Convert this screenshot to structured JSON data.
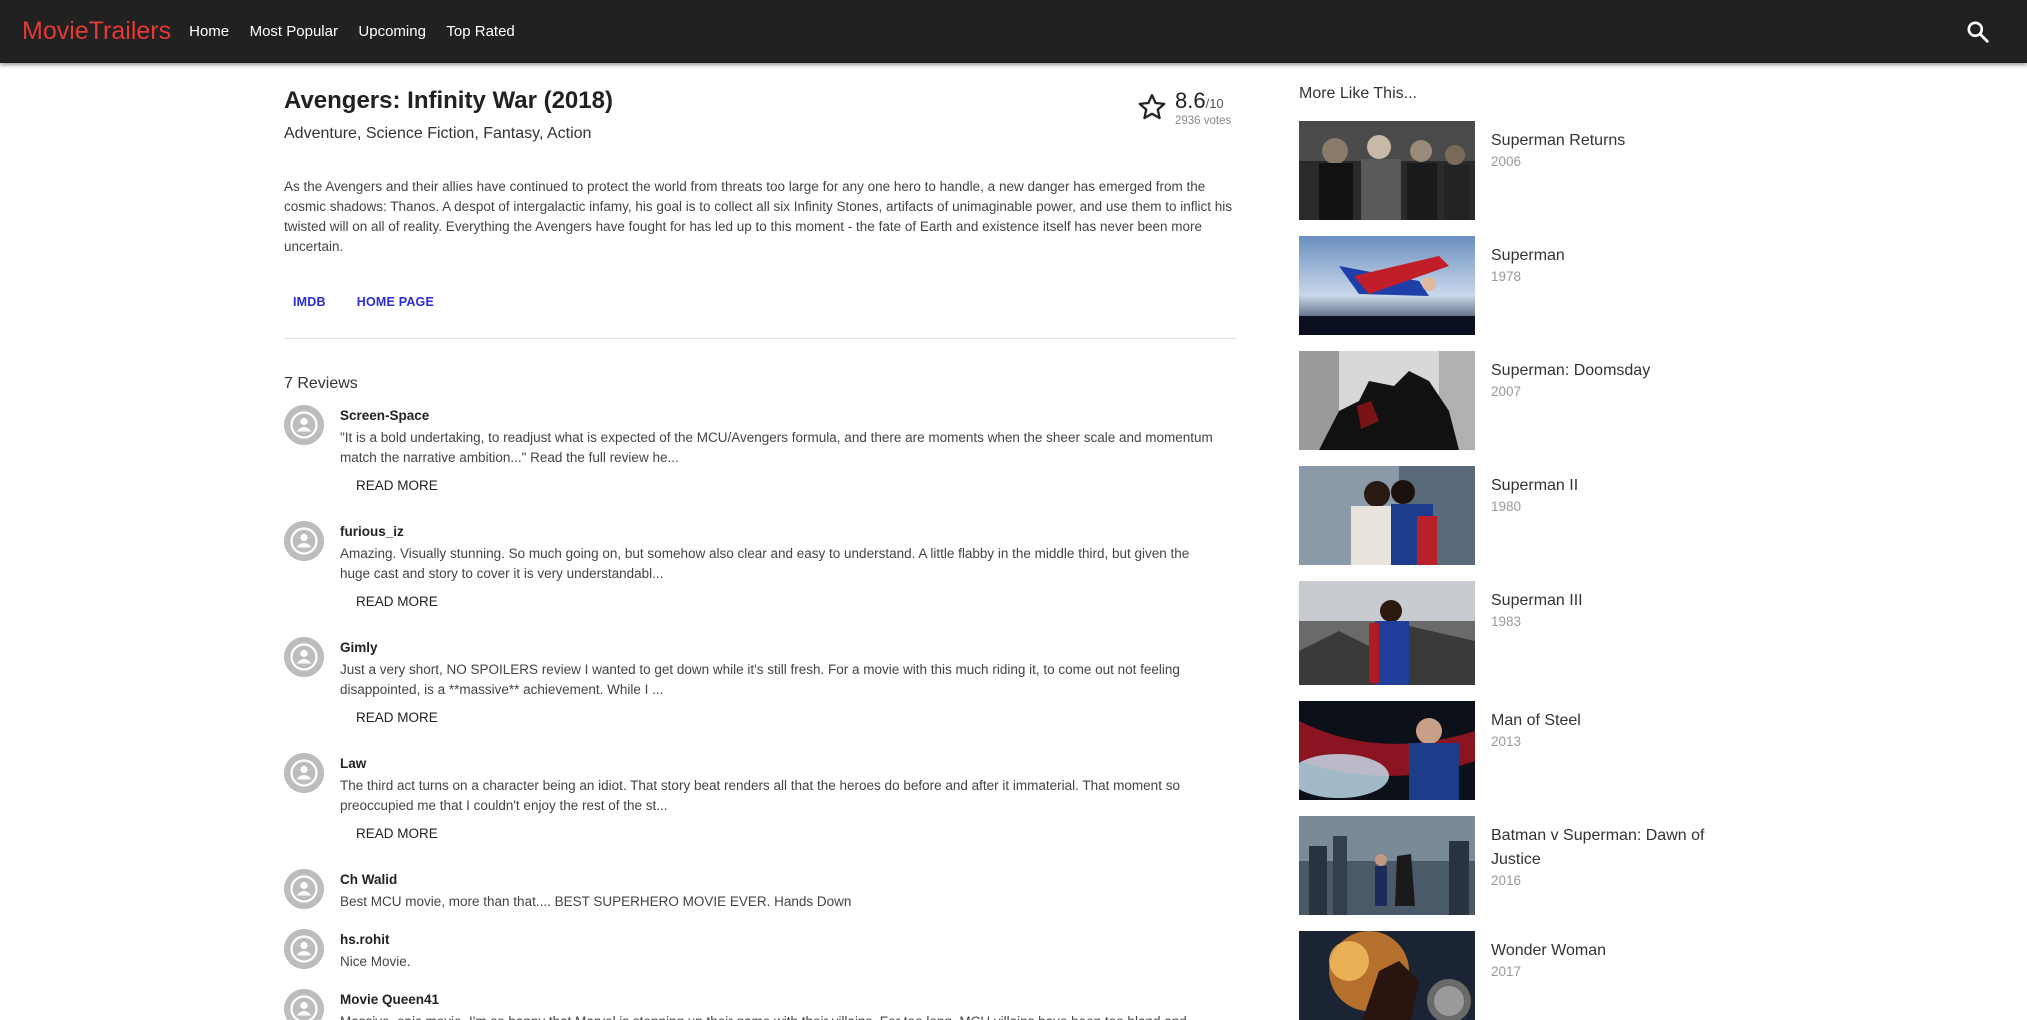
{
  "header": {
    "brand": "MovieTrailers",
    "nav": [
      "Home",
      "Most Popular",
      "Upcoming",
      "Top Rated"
    ],
    "search_icon": "search-icon",
    "brand_color": "#e53935",
    "bar_color": "#212121"
  },
  "movie": {
    "title": "Avengers: Infinity War (2018)",
    "genres": "Adventure, Science Fiction, Fantasy, Action",
    "rating_value": "8.6",
    "rating_max": "/10",
    "votes": "2936 votes",
    "star_icon": "star-outline-icon",
    "overview": "As the Avengers and their allies have continued to protect the world from threats too large for any one hero to handle, a new danger has emerged from the cosmic shadows: Thanos. A despot of intergalactic infamy, his goal is to collect all six Infinity Stones, artifacts of unimaginable power, and use them to inflict his twisted will on all of reality. Everything the Avengers have fought for has led up to this moment - the fate of Earth and existence itself has never been more uncertain.",
    "links": [
      "IMDB",
      "HOME PAGE"
    ],
    "link_color": "#2b2bd6"
  },
  "reviews": {
    "count_label": "7 Reviews",
    "read_more": "READ MORE",
    "items": [
      {
        "author": "Screen-Space",
        "text": "\"It is a bold undertaking, to readjust what is expected of the MCU/Avengers formula, and there are moments when the sheer scale and momentum match the narrative ambition...\"  Read the full review he..."
      },
      {
        "author": "furious_iz",
        "text": "Amazing. Visually stunning. So much going on, but somehow also clear and easy to understand. A little flabby in the middle third, but given the huge cast and story to cover it is very understandabl..."
      },
      {
        "author": "Gimly",
        "text": "Just a very short, NO SPOILERS review I wanted to get down while it's still fresh.  For a movie with this much riding it, to come out not feeling disappointed, is a **massive** achievement. While I ..."
      },
      {
        "author": "Law",
        "text": "The third act turns on a character being an idiot. That story beat renders all that the heroes do before and after it immaterial. That moment so preoccupied me that I couldn't enjoy the rest of the st..."
      },
      {
        "author": "Ch Walid",
        "text": "Best MCU movie, more than that.... BEST SUPERHERO MOVIE EVER. Hands Down"
      },
      {
        "author": "hs.rohit",
        "text": "Nice Movie."
      },
      {
        "author": "Movie Queen41",
        "text": "Massive, epic movie. I'm so happy that Marvel is stepping up their game with their villains. For too long, MCU villains have been too bland and"
      }
    ]
  },
  "sidebar": {
    "title": "More Like This...",
    "items": [
      {
        "name": "Superman Returns",
        "year": "2006"
      },
      {
        "name": "Superman",
        "year": "1978"
      },
      {
        "name": "Superman: Doomsday",
        "year": "2007"
      },
      {
        "name": "Superman II",
        "year": "1980"
      },
      {
        "name": "Superman III",
        "year": "1983"
      },
      {
        "name": "Man of Steel",
        "year": "2013"
      },
      {
        "name": "Batman v Superman: Dawn of Justice",
        "year": "2016"
      },
      {
        "name": "Wonder Woman",
        "year": "2017"
      }
    ]
  }
}
